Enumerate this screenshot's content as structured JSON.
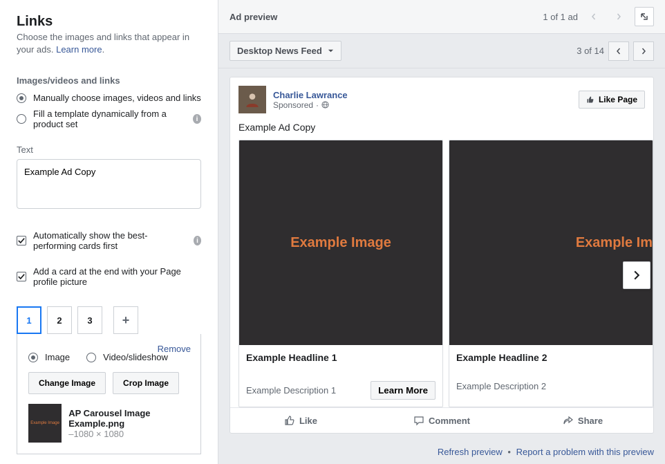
{
  "left": {
    "title": "Links",
    "subtitle_pre": "Choose the images and links that appear in your ads. ",
    "learn_more": "Learn more",
    "period": ".",
    "group_label": "Images/videos and links",
    "radio_manual": "Manually choose images, videos and links",
    "radio_template": "Fill a template dynamically from a product set",
    "text_label": "Text",
    "text_value": "Example Ad Copy",
    "chk_best": "Automatically show the best-performing cards first",
    "chk_page_card": "Add a card at the end with your Page profile picture",
    "tabs": [
      "1",
      "2",
      "3"
    ],
    "remove": "Remove",
    "media_image": "Image",
    "media_video": "Video/slideshow",
    "change_img": "Change Image",
    "crop_img": "Crop Image",
    "filename": "AP Carousel Image Example.png",
    "filedim_prefix": "–",
    "filedim": "1080 × 1080",
    "thumb_text": "Example Image"
  },
  "preview": {
    "header_title": "Ad preview",
    "ad_count": "1 of 1 ad",
    "placement": "Desktop News Feed",
    "placement_count": "3 of 14",
    "page_name": "Charlie Lawrance",
    "sponsored": "Sponsored",
    "like_page": "Like Page",
    "ad_copy": "Example Ad Copy",
    "card1_img": "Example Image",
    "card1_headline": "Example Headline 1",
    "card1_desc": "Example Description 1",
    "card1_cta": "Learn More",
    "card2_img": "Example Im",
    "card2_headline": "Example Headline 2",
    "card2_desc": "Example Description 2",
    "like": "Like",
    "comment": "Comment",
    "share": "Share",
    "refresh": "Refresh preview",
    "report": "Report a problem with this preview"
  }
}
